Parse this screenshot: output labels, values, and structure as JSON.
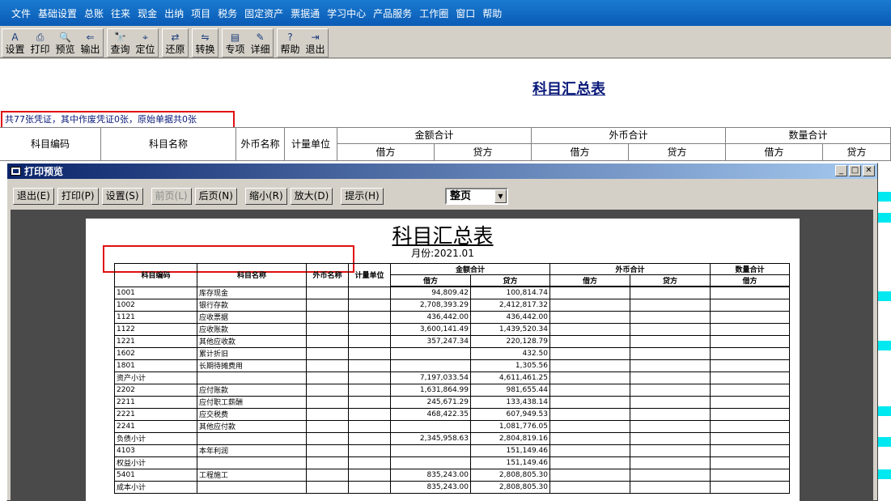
{
  "menu": [
    "文件",
    "基础设置",
    "总账",
    "往来",
    "现金",
    "出纳",
    "项目",
    "税务",
    "固定资产",
    "票据通",
    "学习中心",
    "产品服务",
    "工作圈",
    "窗口",
    "帮助"
  ],
  "toolbar": {
    "groups": [
      [
        {
          "label": "设置",
          "icon": "A"
        },
        {
          "label": "打印",
          "icon": "⎙"
        },
        {
          "label": "预览",
          "icon": "🔍"
        },
        {
          "label": "输出",
          "icon": "⇐"
        }
      ],
      [
        {
          "label": "查询",
          "icon": "🔭"
        },
        {
          "label": "定位",
          "icon": "⌖"
        }
      ],
      [
        {
          "label": "还原",
          "icon": "⇄"
        }
      ],
      [
        {
          "label": "转换",
          "icon": "⇋"
        }
      ],
      [
        {
          "label": "专项",
          "icon": "▤"
        },
        {
          "label": "详细",
          "icon": "✎"
        }
      ],
      [
        {
          "label": "帮助",
          "icon": "?"
        },
        {
          "label": "退出",
          "icon": "⇥"
        }
      ]
    ]
  },
  "main": {
    "title": "科目汇总表",
    "info": "共77张凭证，其中作废凭证0张，原始单据共0张",
    "headers": {
      "code": "科目编码",
      "name": "科目名称",
      "fc_name": "外币名称",
      "unit": "计量单位",
      "amount_total": "金额合计",
      "fc_total": "外币合计",
      "qty_total": "数量合计",
      "debit": "借方",
      "credit": "贷方"
    }
  },
  "dialog": {
    "title": "打印预览",
    "buttons": [
      {
        "label": "退出(E)",
        "enabled": true
      },
      {
        "label": "打印(P)",
        "enabled": true
      },
      {
        "label": "设置(S)",
        "enabled": true
      },
      {
        "label": "前页(L)",
        "enabled": false
      },
      {
        "label": "后页(N)",
        "enabled": true
      },
      {
        "label": "缩小(R)",
        "enabled": true
      },
      {
        "label": "放大(D)",
        "enabled": true
      },
      {
        "label": "提示(H)",
        "enabled": true
      }
    ],
    "zoom_select": "整页",
    "page": {
      "title": "科目汇总表",
      "month": "月份:2021.01",
      "headers": {
        "code": "科目编码",
        "name": "科目名称",
        "fc_name": "外币名称",
        "unit": "计量单位",
        "amount_total": "金额合计",
        "fc_total": "外币合计",
        "qty_total": "数量合计",
        "debit": "借方",
        "credit": "贷方"
      },
      "rows": [
        {
          "code": "1001",
          "name": "库存现金",
          "debit": "94,809.42",
          "credit": "100,814.74"
        },
        {
          "code": "1002",
          "name": "银行存款",
          "debit": "2,708,393.29",
          "credit": "2,412,817.32"
        },
        {
          "code": "1121",
          "name": "应收票据",
          "debit": "436,442.00",
          "credit": "436,442.00"
        },
        {
          "code": "1122",
          "name": "应收账款",
          "debit": "3,600,141.49",
          "credit": "1,439,520.34"
        },
        {
          "code": "1221",
          "name": "其他应收款",
          "debit": "357,247.34",
          "credit": "220,128.79"
        },
        {
          "code": "1602",
          "name": "累计折旧",
          "debit": "",
          "credit": "432.50"
        },
        {
          "code": "1801",
          "name": "长期待摊费用",
          "debit": "",
          "credit": "1,305.56"
        },
        {
          "code": "资产小计",
          "name": "",
          "debit": "7,197,033.54",
          "credit": "4,611,461.25"
        },
        {
          "code": "2202",
          "name": "应付账款",
          "debit": "1,631,864.99",
          "credit": "981,655.44"
        },
        {
          "code": "2211",
          "name": "应付职工薪酬",
          "debit": "245,671.29",
          "credit": "133,438.14"
        },
        {
          "code": "2221",
          "name": "应交税费",
          "debit": "468,422.35",
          "credit": "607,949.53"
        },
        {
          "code": "2241",
          "name": "其他应付款",
          "debit": "",
          "credit": "1,081,776.05"
        },
        {
          "code": "负债小计",
          "name": "",
          "debit": "2,345,958.63",
          "credit": "2,804,819.16"
        },
        {
          "code": "4103",
          "name": "本年利润",
          "debit": "",
          "credit": "151,149.46"
        },
        {
          "code": "权益小计",
          "name": "",
          "debit": "",
          "credit": "151,149.46"
        },
        {
          "code": "5401",
          "name": "工程施工",
          "debit": "835,243.00",
          "credit": "2,808,805.30"
        },
        {
          "code": "成本小计",
          "name": "",
          "debit": "835,243.00",
          "credit": "2,808,805.30"
        }
      ]
    }
  },
  "colors": {
    "menubar": "#0a5bb5",
    "title_blue": "#0a1a7a",
    "highlight_red": "#e01010",
    "accent_cyan": "#00e8f0"
  }
}
